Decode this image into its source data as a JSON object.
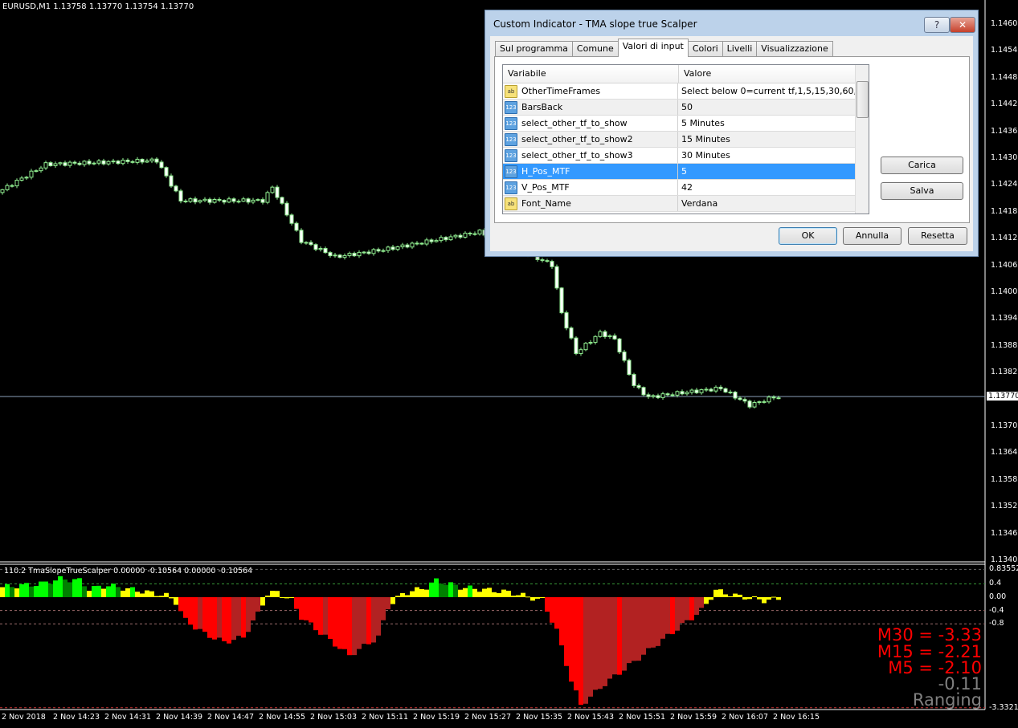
{
  "chart_header": {
    "symbol_info": "EURUSD,M1  1.13758 1.13770 1.13754 1.13770"
  },
  "price_axis": {
    "labels": [
      "1.14605",
      "1.14545",
      "1.14485",
      "1.14425",
      "1.14365",
      "1.14305",
      "1.14245",
      "1.14185",
      "1.14125",
      "1.14065",
      "1.14005",
      "1.13945",
      "1.13885",
      "1.13825",
      "1.13705",
      "1.13645",
      "1.13585",
      "1.13525",
      "1.13465",
      "1.13405"
    ],
    "current_price": "1.13770"
  },
  "indicator": {
    "title": "110.2 TmaSlopeTrueScalper 0.00000 -0.10564 0.00000 -0.10564",
    "axis_labels": [
      "0.83552",
      "0.4",
      "0.00",
      "-0.4",
      "-0.8",
      "-3.33218"
    ],
    "levels": [
      0.4,
      -0.4,
      -0.8
    ],
    "mtf": [
      {
        "text": "M30 = -3.33",
        "color": "#ff0000"
      },
      {
        "text": "M15 = -2.21",
        "color": "#ff0000"
      },
      {
        "text": "M5 = -2.10",
        "color": "#ff0000"
      },
      {
        "text": "-0.11",
        "color": "#808080"
      },
      {
        "text": "Ranging",
        "color": "#808080"
      }
    ],
    "colors": {
      "strong_up": "#00ff00",
      "strong_up_dark": "#008000",
      "neutral": "#ffff00",
      "strong_down": "#ff0000",
      "strong_down_dark": "#b22222"
    },
    "histogram_path": [
      [
        0,
        0.3
      ],
      [
        8,
        0.4
      ],
      [
        12,
        0.55
      ],
      [
        16,
        0.5
      ],
      [
        18,
        0.25
      ],
      [
        22,
        0.35
      ],
      [
        30,
        0.15
      ],
      [
        34,
        0.05
      ],
      [
        36,
        -0.15
      ],
      [
        38,
        -0.7
      ],
      [
        42,
        -1.1
      ],
      [
        46,
        -1.35
      ],
      [
        50,
        -1.2
      ],
      [
        53,
        -0.5
      ],
      [
        55,
        0.1
      ],
      [
        57,
        0.15
      ],
      [
        60,
        -0.1
      ],
      [
        62,
        -0.6
      ],
      [
        68,
        -1.3
      ],
      [
        72,
        -1.75
      ],
      [
        78,
        -1.2
      ],
      [
        80,
        -0.3
      ],
      [
        83,
        0.1
      ],
      [
        88,
        0.3
      ],
      [
        90,
        0.5
      ],
      [
        95,
        0.3
      ],
      [
        105,
        0.15
      ],
      [
        108,
        0.05
      ],
      [
        112,
        -0.1
      ],
      [
        115,
        -1.0
      ],
      [
        118,
        -2.5
      ],
      [
        120,
        -3.25
      ],
      [
        125,
        -2.6
      ],
      [
        135,
        -1.5
      ],
      [
        145,
        -0.4
      ],
      [
        148,
        0.2
      ],
      [
        152,
        0.05
      ],
      [
        158,
        -0.1
      ],
      [
        161,
        -0.05
      ]
    ]
  },
  "price_path": [
    [
      0,
      1.14228
    ],
    [
      10,
      1.14291
    ],
    [
      33,
      1.143
    ],
    [
      38,
      1.1421
    ],
    [
      55,
      1.1421
    ],
    [
      57,
      1.1424
    ],
    [
      63,
      1.1412
    ],
    [
      70,
      1.14084
    ],
    [
      80,
      1.141
    ],
    [
      90,
      1.1412
    ],
    [
      100,
      1.1414
    ],
    [
      106,
      1.1411
    ],
    [
      115,
      1.14066
    ],
    [
      117,
      1.13958
    ],
    [
      120,
      1.13869
    ],
    [
      125,
      1.13914
    ],
    [
      128,
      1.139
    ],
    [
      132,
      1.13797
    ],
    [
      135,
      1.1377
    ],
    [
      142,
      1.1378
    ],
    [
      150,
      1.1379
    ],
    [
      156,
      1.13752
    ],
    [
      161,
      1.1377
    ]
  ],
  "time_axis": [
    "2 Nov 2018",
    "2 Nov 14:23",
    "2 Nov 14:31",
    "2 Nov 14:39",
    "2 Nov 14:47",
    "2 Nov 14:55",
    "2 Nov 15:03",
    "2 Nov 15:11",
    "2 Nov 15:19",
    "2 Nov 15:27",
    "2 Nov 15:35",
    "2 Nov 15:43",
    "2 Nov 15:51",
    "2 Nov 15:59",
    "2 Nov 16:07",
    "2 Nov 16:15"
  ],
  "dialog": {
    "title": "Custom Indicator - TMA slope true Scalper",
    "help": "?",
    "close": "✕",
    "tabs": [
      "Sul programma",
      "Comune",
      "Valori di input",
      "Colori",
      "Livelli",
      "Visualizzazione"
    ],
    "active_tab": "Valori di input",
    "columns": [
      "Variabile",
      "Valore"
    ],
    "rows": [
      {
        "type": "ab",
        "name": "OtherTimeFrames",
        "value": "Select below 0=current tf,1,5,15,30,60,240..."
      },
      {
        "type": "123",
        "name": "BarsBack",
        "value": "50"
      },
      {
        "type": "123",
        "name": "select_other_tf_to_show",
        "value": "5 Minutes"
      },
      {
        "type": "123",
        "name": "select_other_tf_to_show2",
        "value": "15 Minutes"
      },
      {
        "type": "123",
        "name": "select_other_tf_to_show3",
        "value": "30 Minutes"
      },
      {
        "type": "123",
        "name": "H_Pos_MTF",
        "value": "5",
        "selected": true
      },
      {
        "type": "123",
        "name": "V_Pos_MTF",
        "value": "42"
      },
      {
        "type": "ab",
        "name": "Font_Name",
        "value": "Verdana"
      }
    ],
    "buttons": {
      "load": "Carica",
      "save": "Salva",
      "ok": "OK",
      "cancel": "Annulla",
      "reset": "Resetta"
    }
  }
}
